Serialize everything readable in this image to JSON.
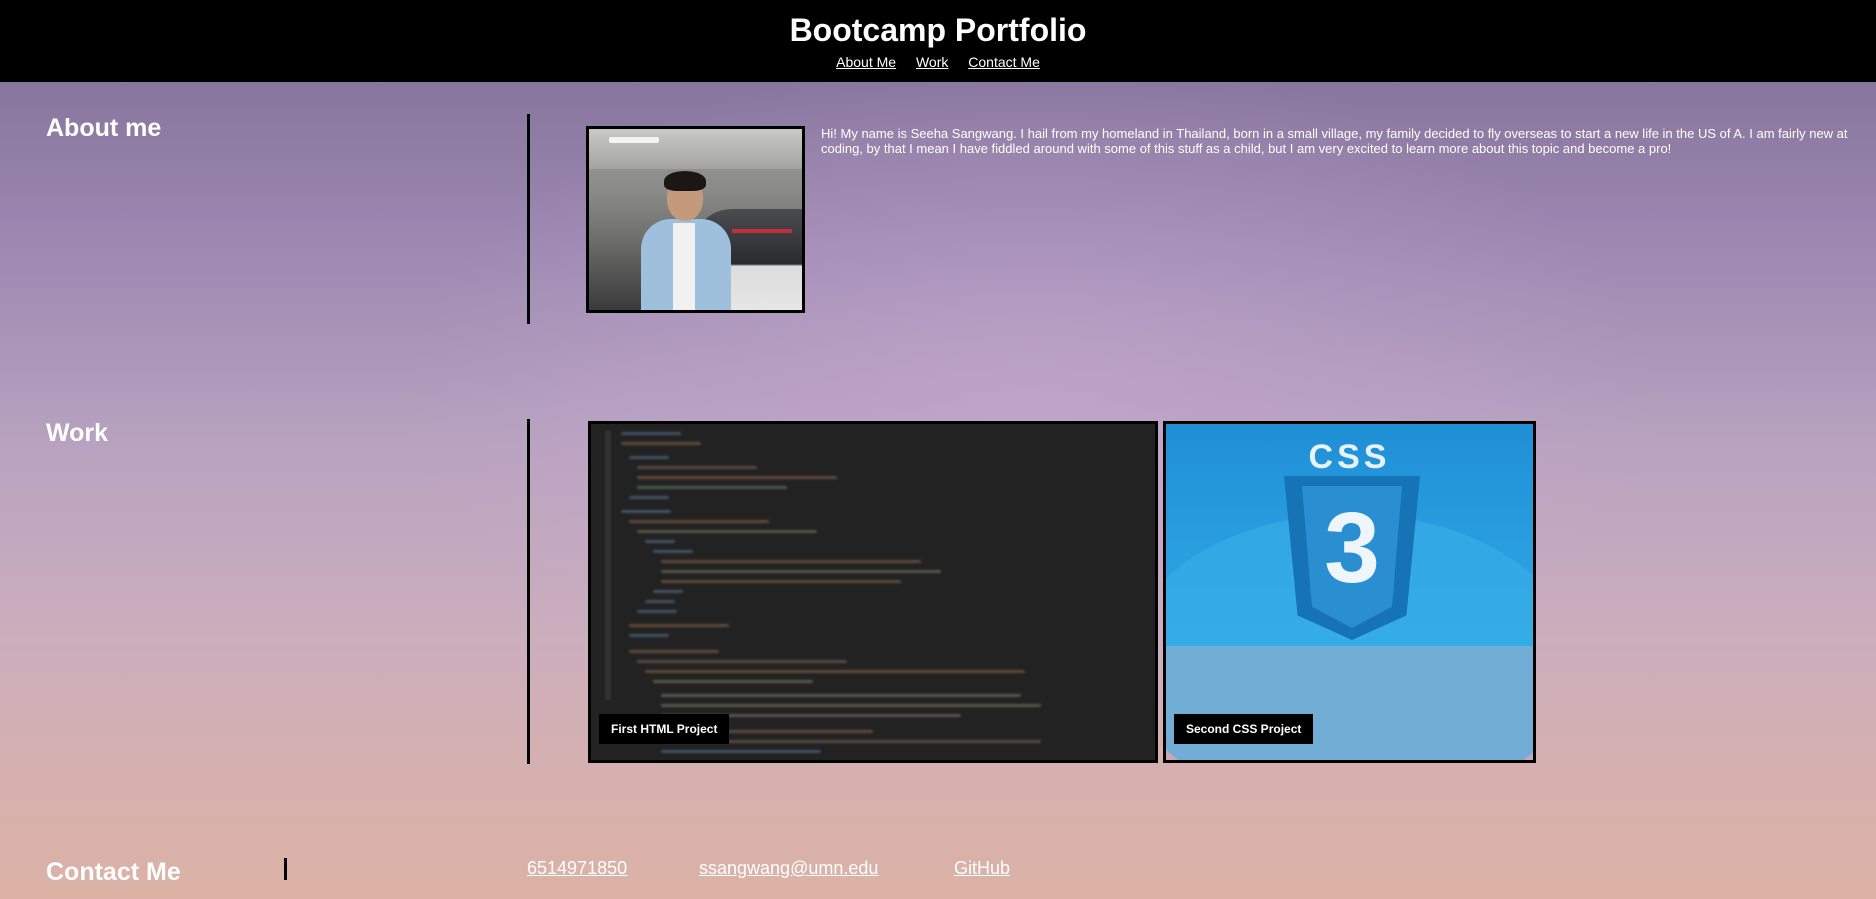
{
  "header": {
    "title": "Bootcamp Portfolio",
    "nav": [
      "About Me",
      "Work",
      "Contact Me"
    ]
  },
  "about": {
    "title": "About me",
    "text": "Hi! My name is Seeha Sangwang. I hail from my homeland in Thailand, born in a small village, my family decided to fly overseas to start a new life in the US of A. I am fairly new at coding, by that I mean I have fiddled around with some of this stuff as a child, but I am very excited to learn more about this topic and become a pro!"
  },
  "work": {
    "title": "Work",
    "projects": [
      {
        "label": "First HTML Project"
      },
      {
        "label": "Second CSS Project"
      }
    ],
    "css_image_text": "CSS"
  },
  "contact": {
    "title": "Contact Me",
    "phone": "6514971850",
    "email": "ssangwang@umn.edu",
    "github": "GitHub"
  }
}
